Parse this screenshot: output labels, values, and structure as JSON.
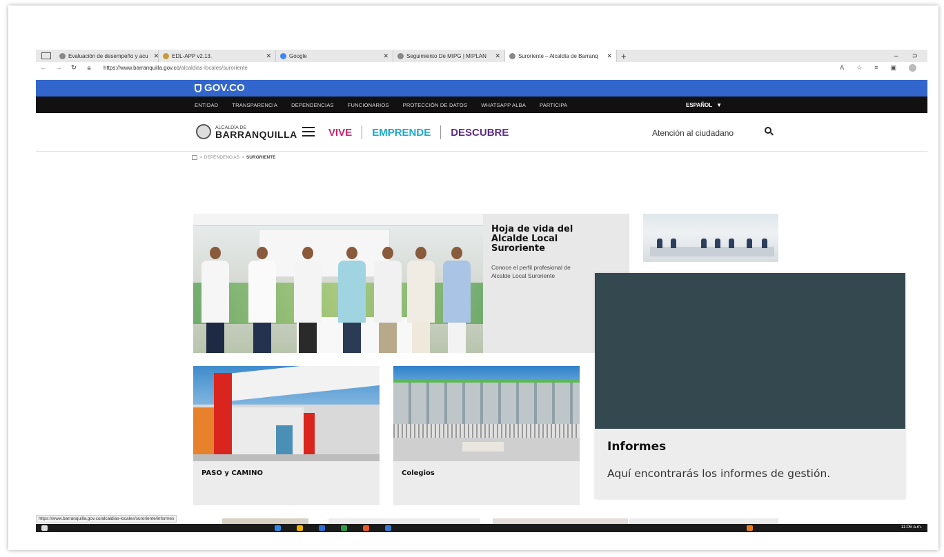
{
  "browser": {
    "tabs": [
      {
        "label": "Evaluación de desempeño y acu",
        "active": false
      },
      {
        "label": "EDL-APP v2.13.",
        "active": false
      },
      {
        "label": "Google",
        "active": false
      },
      {
        "label": "Seguimiento De MIPG | MIPLAN",
        "active": false
      },
      {
        "label": "Suroriente – Alcaldía de Barranq",
        "active": true
      }
    ],
    "new_tab": "+",
    "url_host": "https://www.barranquilla.gov.co",
    "url_path": "/alcaldias-locales/suroriente",
    "window_controls": [
      "–",
      "⊃"
    ]
  },
  "gov_bar": {
    "logo_text": "GOV.CO"
  },
  "entity_menu": {
    "items": [
      "ENTIDAD",
      "TRANSPARENCIA",
      "DEPENDENCIAS",
      "FUNCIONARIOS",
      "PROTECCIÓN DE DATOS",
      "WHATSAPP ALBA",
      "PARTICIPA"
    ],
    "language": "ESPAÑOL"
  },
  "site_header": {
    "logo_small": "ALCALDÍA DE",
    "logo_big": "BARRANQUILLA",
    "nav": [
      {
        "label": "VIVE",
        "color": "#c8256b"
      },
      {
        "label": "EMPRENDE",
        "color": "#1da7c9"
      },
      {
        "label": "DESCUBRE",
        "color": "#5b2d86"
      }
    ],
    "atencion": "Atención al ciudadano"
  },
  "breadcrumb": {
    "items": [
      "DEPENDENCIAS",
      "SURORIENTE"
    ]
  },
  "cards": {
    "hoja": {
      "title": "Hoja de vida del Alcalde Local Suroriente",
      "desc_line1": "Conoce el perfil profesional de",
      "desc_line2": "Alcalde Local Suroriente"
    },
    "informes": {
      "title": "Informes",
      "desc": "Aquí encontrarás los informes de gestión."
    },
    "paso": {
      "title": "PASO y CAMINO"
    },
    "colegios": {
      "title": "Colegios"
    }
  },
  "status_url": "https://www.barranquilla.gov.co/alcaldias-locales/suroriente/informes",
  "taskbar": {
    "clock": "11:06 a.m."
  }
}
